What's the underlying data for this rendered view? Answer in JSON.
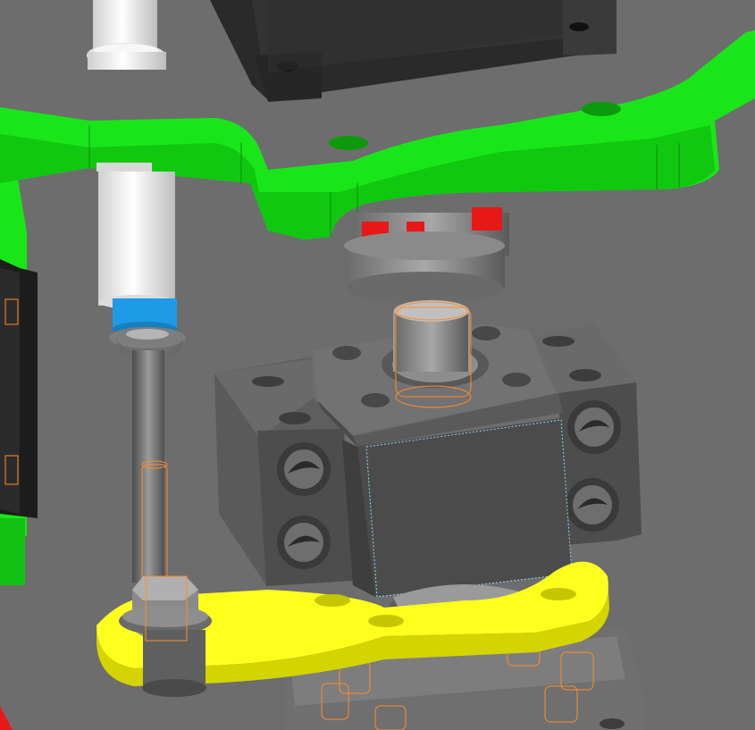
{
  "scene": {
    "background": "#6d6d6d",
    "colors": {
      "plate_green": "#19e619",
      "plate_green_dark": "#0fb80f",
      "bracket_yellow": "#ffff1e",
      "bracket_yellow_dark": "#d4d400",
      "metal_gray": "#5a5a5a",
      "metal_light": "#8a8a8a",
      "coupling_red": "#e81818",
      "sleeve_blue": "#1e9be6",
      "rod_white": "#f4f4f4",
      "hidden_edge_orange": "#ff8c28",
      "motor_black": "#222222"
    },
    "parts": [
      "mounting-plate",
      "stepper-motor",
      "flexible-coupling",
      "bearing-block",
      "lead-screw",
      "guide-rod",
      "hex-nut",
      "yellow-bracket",
      "lower-motor-housing",
      "left-side-panel"
    ]
  }
}
